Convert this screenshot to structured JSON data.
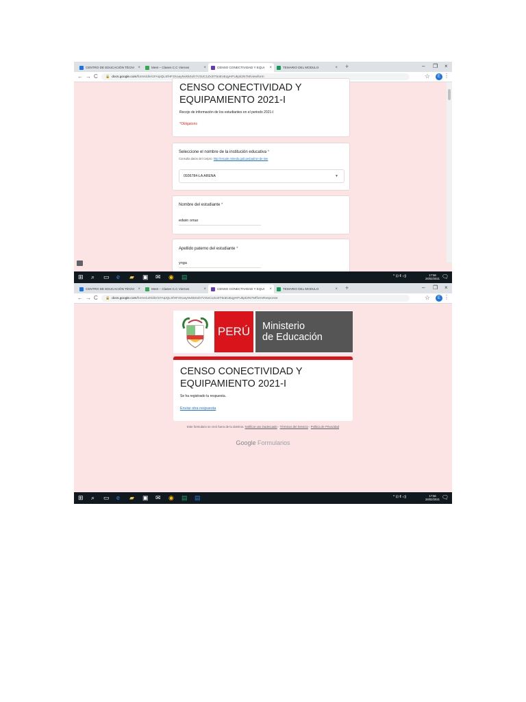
{
  "browser": {
    "tabs": [
      {
        "title": "CENTRO DE EDUCACIÓN TÉCNI",
        "color": "#1a73e8"
      },
      {
        "title": "Meet – Clases C.C Viernes",
        "color": "#34a853"
      },
      {
        "title": "CENSO CONECTIVIDAD Y EQUI",
        "color": "#673ab7"
      },
      {
        "title": "TEMARIO DEL MODULO",
        "color": "#0f9d58"
      }
    ],
    "tab_close": "×",
    "new_tab": "+",
    "win_min": "–",
    "win_max": "❐",
    "win_close": "×",
    "nav_back": "←",
    "nav_forward": "→",
    "nav_reload": "C",
    "profile_initial": "E"
  },
  "screenshot1": {
    "url_host": "docs.google.com",
    "url_path": "/forms/d/e/1FAIpQLSfHF3XoayNvk5Soh7V3UC1Zx3IT5oEoEqyHFUkpIi2N7M/viewform",
    "form_title": "CENSO CONECTIVIDAD Y EQUIPAMIENTO 2021-I",
    "description": "Recojo de información de los estudiantes en el periodo 2021-I",
    "required_note": "*Obligatorio",
    "q1_label": "Seleccione el nombre de la institución educativa",
    "q1_required": "*",
    "q1_hint": "Consulta datos del Cetpro:",
    "q1_hint_link": "http://escale.minedu.gob.pe/padron-de-iiee",
    "q1_value": "0936784-LA ARENA",
    "q2_label": "Nombre del estudiante",
    "q2_required": "*",
    "q2_value": "edwin omar",
    "q3_label": "Apellido paterno del estudiante",
    "q3_required": "*",
    "q3_value": "ynga",
    "clock_time": "17:58",
    "clock_date": "26/02/2021"
  },
  "screenshot2": {
    "url_host": "docs.google.com",
    "url_path": "/forms/u/0/d/e/1FAIpQLSfHF3XoayNvk5Soh7V3UC1Zx3IT5oEoEqyHFUkpIi2N7M/formResponse",
    "logo_peru": "PERÚ",
    "logo_ministerio_1": "Ministerio",
    "logo_ministerio_2": "de Educación",
    "seal_text": "REPÚBLICA DEL PERÚ",
    "form_title": "CENSO CONECTIVIDAD Y EQUIPAMIENTO 2021-I",
    "confirmation": "Se ha registrado tu respuesta.",
    "another_response": "Enviar otra respuesta",
    "footer_prefix": "Este formulario se creó fuera de tu dominio.",
    "footer_report": "Notificar uso inadecuado",
    "footer_terms": "Términos del Servicio",
    "footer_privacy": "Política de Privacidad",
    "brand_google": "Google",
    "brand_forms": "Formularios",
    "clock_time": "17:56",
    "clock_date": "26/02/2021"
  },
  "taskbar": {
    "tray_text": "^ ⊡ ¢ ◁)",
    "notification_icon": "🗨"
  }
}
